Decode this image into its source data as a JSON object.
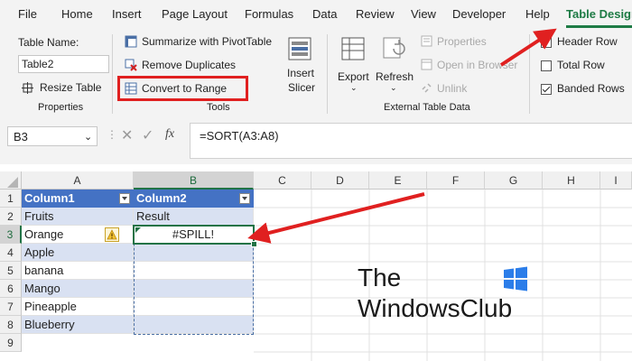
{
  "menu": {
    "items": [
      "File",
      "Home",
      "Insert",
      "Page Layout",
      "Formulas",
      "Data",
      "Review",
      "View",
      "Developer",
      "Help",
      "Table Design"
    ],
    "active": "Table Design"
  },
  "ribbon": {
    "properties": {
      "table_name_label": "Table Name:",
      "table_name_value": "Table2",
      "resize_table": "Resize Table",
      "group_label": "Properties"
    },
    "tools": {
      "summarize": "Summarize with PivotTable",
      "remove_duplicates": "Remove Duplicates",
      "convert_to_range": "Convert to Range",
      "insert_slicer_line1": "Insert",
      "insert_slicer_line2": "Slicer",
      "group_label": "Tools"
    },
    "external": {
      "export": "Export",
      "refresh": "Refresh",
      "properties": "Properties",
      "open_in_browser": "Open in Browser",
      "unlink": "Unlink",
      "group_label": "External Table Data"
    },
    "style_options": {
      "header_row": "Header Row",
      "total_row": "Total Row",
      "banded_rows": "Banded Rows",
      "header_row_checked": true,
      "total_row_checked": false,
      "banded_rows_checked": true
    }
  },
  "formula_bar": {
    "name_box": "B3",
    "formula": "=SORT(A3:A8)",
    "fx": "fx"
  },
  "grid": {
    "columns": [
      "A",
      "B",
      "C",
      "D",
      "E",
      "F",
      "G",
      "H",
      "I"
    ],
    "rows": [
      "1",
      "2",
      "3",
      "4",
      "5",
      "6",
      "7",
      "8",
      "9"
    ],
    "col_a": [
      "Column1",
      "Fruits",
      "Orange",
      "Apple",
      "banana",
      "Mango",
      "Pineapple",
      "Blueberry"
    ],
    "col_b": [
      "Column2",
      "Result",
      "#SPILL!",
      "",
      "",
      "",
      "",
      ""
    ],
    "selected_cell": "B3"
  },
  "watermark": {
    "line1": "The",
    "line2": "WindowsClub"
  },
  "colors": {
    "accent": "#1e7b45",
    "table_header": "#4472c4",
    "band": "#d9e1f2",
    "annotation": "#e02020"
  }
}
